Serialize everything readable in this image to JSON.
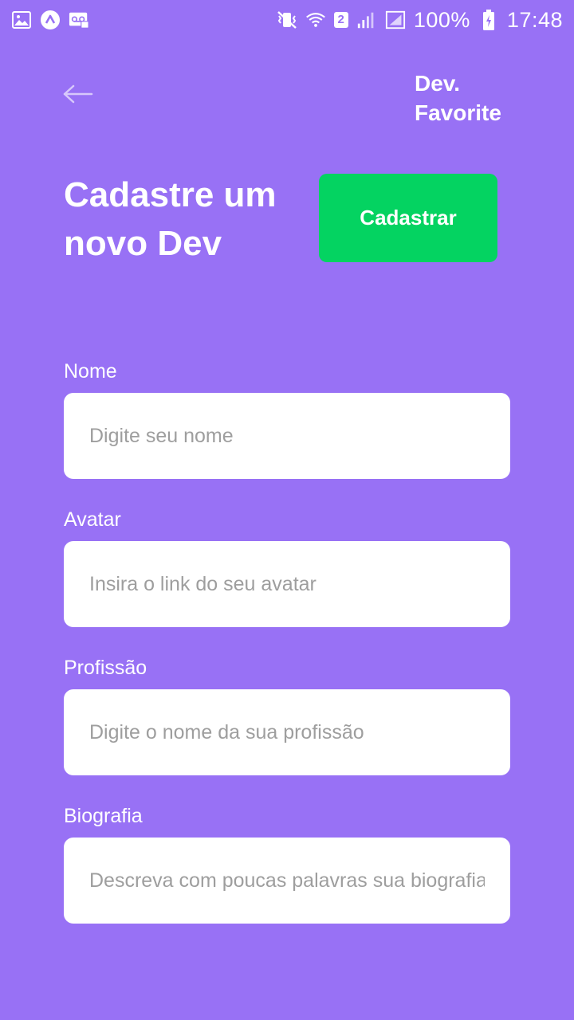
{
  "status_bar": {
    "left_icons": [
      "image-icon",
      "app-icon",
      "voicemail-icon"
    ],
    "sim_badge": "2",
    "battery": "100%",
    "time": "17:48"
  },
  "header": {
    "back_icon": "arrow-left-icon",
    "brand_line1": "Dev.",
    "brand_line2": "Favorite",
    "title_line1": "Cadastre um",
    "title_line2": "novo Dev",
    "submit_label": "Cadastrar"
  },
  "form": {
    "name": {
      "label": "Nome",
      "placeholder": "Digite seu nome",
      "value": ""
    },
    "avatar": {
      "label": "Avatar",
      "placeholder": "Insira o link do seu avatar",
      "value": ""
    },
    "profession": {
      "label": "Profissão",
      "placeholder": "Digite o nome da sua profissão",
      "value": ""
    },
    "bio": {
      "label": "Biografia",
      "placeholder": "Descreva com poucas palavras sua biografia",
      "value": ""
    }
  },
  "colors": {
    "background": "#9871f5",
    "accent_button": "#04d361",
    "text": "#ffffff",
    "placeholder": "#9e9e9e"
  }
}
